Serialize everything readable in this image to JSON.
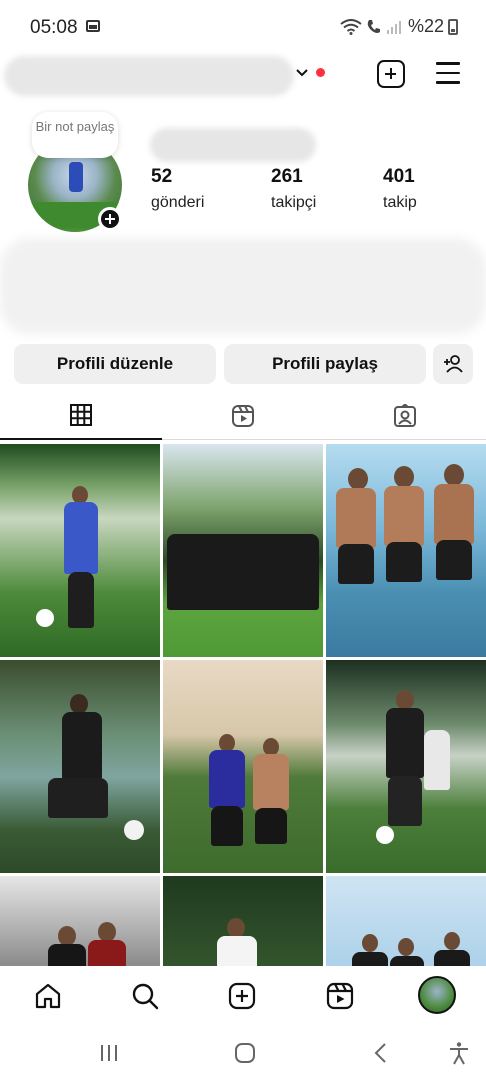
{
  "status_bar": {
    "time": "05:08",
    "battery": "%22"
  },
  "header": {
    "notification_dot_color": "#ff3040"
  },
  "profile": {
    "note": "Bir not paylaş",
    "stats": [
      {
        "value": "52",
        "label": "gönderi"
      },
      {
        "value": "261",
        "label": "takipçi"
      },
      {
        "value": "401",
        "label": "takip"
      }
    ]
  },
  "actions": {
    "edit_profile": "Profili düzenle",
    "share_profile": "Profili paylaş"
  },
  "tabs": [
    {
      "icon": "grid-icon",
      "active": true
    },
    {
      "icon": "reels-icon",
      "active": false
    },
    {
      "icon": "tagged-icon",
      "active": false
    }
  ],
  "bottom_nav": [
    "home-icon",
    "search-icon",
    "create-icon",
    "reels-icon",
    "profile-avatar"
  ],
  "system_nav": [
    "recent-apps-icon",
    "home-button-icon",
    "back-icon",
    "accessibility-icon"
  ]
}
